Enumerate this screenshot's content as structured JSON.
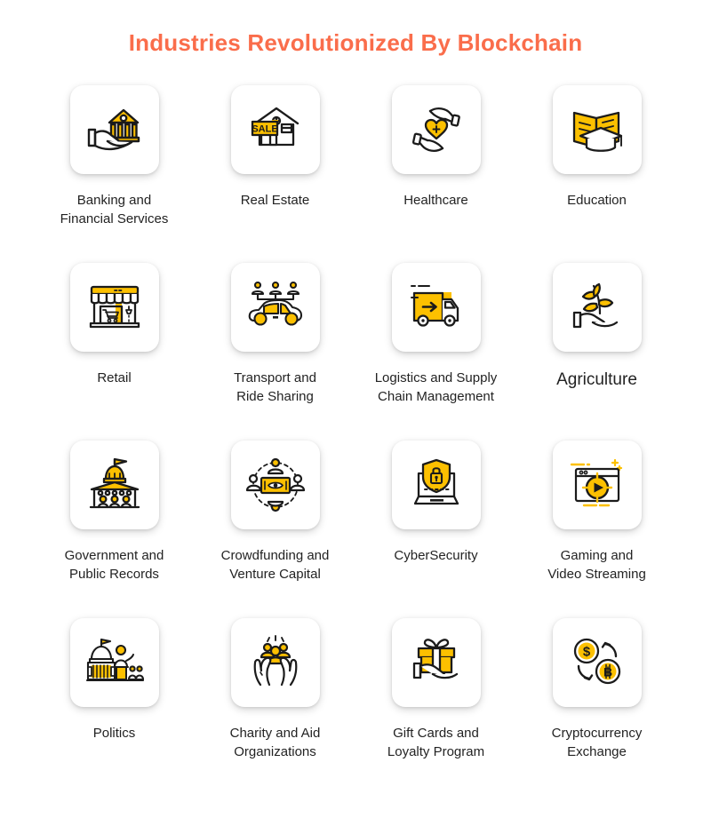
{
  "header": {
    "title": "Industries Revolutionized By Blockchain",
    "title_color": "#fa6d4b"
  },
  "theme": {
    "accent_yellow": "#fcc000",
    "outline_black": "#1b1b1b",
    "label_color": "#232323",
    "card_background": "#ffffff",
    "page_background": "#ffffff"
  },
  "industries": [
    {
      "label": "Banking and\nFinancial Services",
      "line1": "Banking and",
      "line2": "Financial Services",
      "icon": "hand-bank-icon",
      "emphasis": false
    },
    {
      "label": "Real Estate",
      "line1": "Real Estate",
      "line2": "",
      "icon": "house-sale-sign-icon",
      "emphasis": false
    },
    {
      "label": "Healthcare",
      "line1": "Healthcare",
      "line2": "",
      "icon": "hands-heart-cross-icon",
      "emphasis": false
    },
    {
      "label": "Education",
      "line1": "Education",
      "line2": "",
      "icon": "book-graduation-cap-icon",
      "emphasis": false
    },
    {
      "label": "Retail",
      "line1": "Retail",
      "line2": "",
      "icon": "storefront-cart-icon",
      "emphasis": false
    },
    {
      "label": "Transport and\nRide Sharing",
      "line1": "Transport and",
      "line2": "Ride Sharing",
      "icon": "car-riders-icon",
      "emphasis": false
    },
    {
      "label": "Logistics and Supply\nChain Management",
      "line1": "Logistics and Supply",
      "line2": "Chain Management",
      "icon": "delivery-truck-arrow-icon",
      "emphasis": false
    },
    {
      "label": "Agriculture",
      "line1": "Agriculture",
      "line2": "",
      "icon": "hand-sprout-icon",
      "emphasis": true
    },
    {
      "label": "Government and\nPublic Records",
      "line1": "Government and",
      "line2": "Public Records",
      "icon": "capitol-building-icon",
      "emphasis": false
    },
    {
      "label": "Crowdfunding and\nVenture Capital",
      "line1": "Crowdfunding and",
      "line2": "Venture Capital",
      "icon": "people-around-money-icon",
      "emphasis": false
    },
    {
      "label": "CyberSecurity",
      "line1": "CyberSecurity",
      "line2": "",
      "icon": "laptop-shield-lock-icon",
      "emphasis": false
    },
    {
      "label": "Gaming and\nVideo Streaming",
      "line1": "Gaming and",
      "line2": "Video Streaming",
      "icon": "browser-play-button-icon",
      "emphasis": false
    },
    {
      "label": "Politics",
      "line1": "Politics",
      "line2": "",
      "icon": "capitol-speaker-podium-icon",
      "emphasis": false
    },
    {
      "label": "Charity and Aid\nOrganizations",
      "line1": "Charity and Aid",
      "line2": "Organizations",
      "icon": "hands-holding-people-icon",
      "emphasis": false
    },
    {
      "label": "Gift Cards and\nLoyalty Program",
      "line1": "Gift Cards and",
      "line2": "Loyalty Program",
      "icon": "hand-gift-box-icon",
      "emphasis": false
    },
    {
      "label": "Cryptocurrency\nExchange",
      "line1": "Cryptocurrency",
      "line2": "Exchange",
      "icon": "dollar-bitcoin-exchange-icon",
      "emphasis": false
    }
  ],
  "icon_text": {
    "sale_sign": "SALE",
    "dollar_symbol": "$",
    "bitcoin_symbol": "B"
  }
}
